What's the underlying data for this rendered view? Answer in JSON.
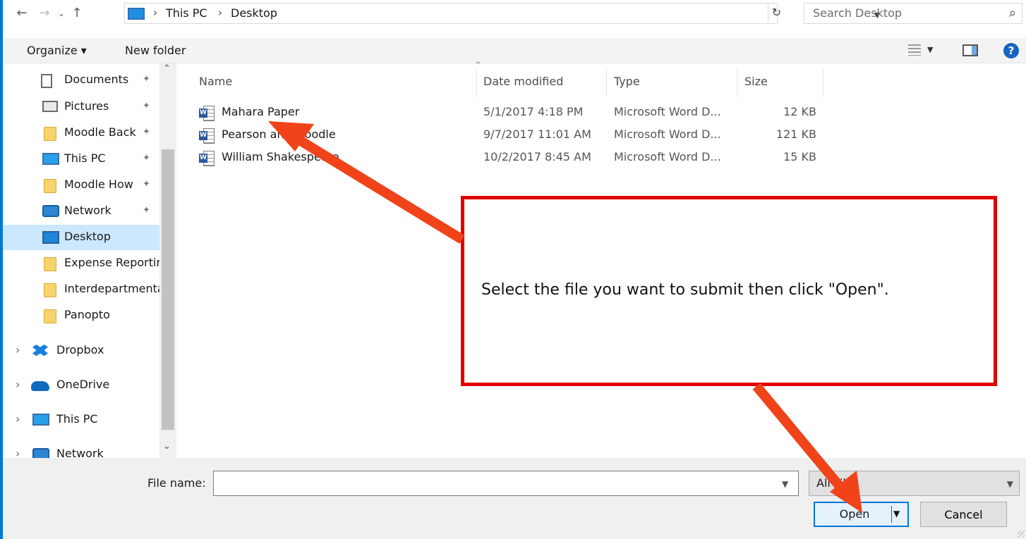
{
  "address": {
    "crumbs": [
      "This PC",
      "Desktop"
    ],
    "separator": "›"
  },
  "search": {
    "placeholder": "Search Desktop"
  },
  "toolbar": {
    "organize": "Organize ▾",
    "new_folder": "New folder"
  },
  "nav_pane": {
    "items": [
      {
        "label": "Documents",
        "icon": "documents-icon",
        "pinned": true
      },
      {
        "label": "Pictures",
        "icon": "pictures-icon",
        "pinned": true
      },
      {
        "label": "Moodle Back",
        "icon": "folder-icon",
        "pinned": true
      },
      {
        "label": "This PC",
        "icon": "computer-icon",
        "pinned": true
      },
      {
        "label": "Moodle How",
        "icon": "folder-icon",
        "pinned": true
      },
      {
        "label": "Network",
        "icon": "network-icon",
        "pinned": true
      },
      {
        "label": "Desktop",
        "icon": "desktop-icon",
        "selected": true
      },
      {
        "label": "Expense Reporting",
        "icon": "folder-icon"
      },
      {
        "label": "Interdepartmental",
        "icon": "folder-icon"
      },
      {
        "label": "Panopto",
        "icon": "folder-icon"
      },
      {
        "label": "Dropbox",
        "icon": "dropbox-icon",
        "expandable": true
      },
      {
        "label": "OneDrive",
        "icon": "onedrive-icon",
        "expandable": true
      },
      {
        "label": "This PC",
        "icon": "computer-icon",
        "expandable": true
      },
      {
        "label": "Network",
        "icon": "network-icon",
        "expandable": true
      }
    ]
  },
  "file_list": {
    "columns": [
      "Name",
      "Date modified",
      "Type",
      "Size"
    ],
    "rows": [
      {
        "name": "Mahara Paper",
        "date": "5/1/2017 4:18 PM",
        "type": "Microsoft Word D...",
        "size": "12 KB"
      },
      {
        "name": "Pearson and Moodle",
        "date": "9/7/2017 11:01 AM",
        "type": "Microsoft Word D...",
        "size": "121 KB"
      },
      {
        "name": "William Shakespeare",
        "date": "10/2/2017 8:45 AM",
        "type": "Microsoft Word D...",
        "size": "15 KB"
      }
    ]
  },
  "callout": {
    "text": "Select the file you want to submit then click \"Open\"."
  },
  "bottom": {
    "file_name_label": "File name:",
    "file_name_value": "",
    "file_type_filter": "All Files",
    "open_label": "Open",
    "cancel_label": "Cancel"
  },
  "colors": {
    "accent": "#0078d7",
    "callout_border": "#e00000",
    "arrow": "#f0431a",
    "selection": "#cce8ff"
  }
}
